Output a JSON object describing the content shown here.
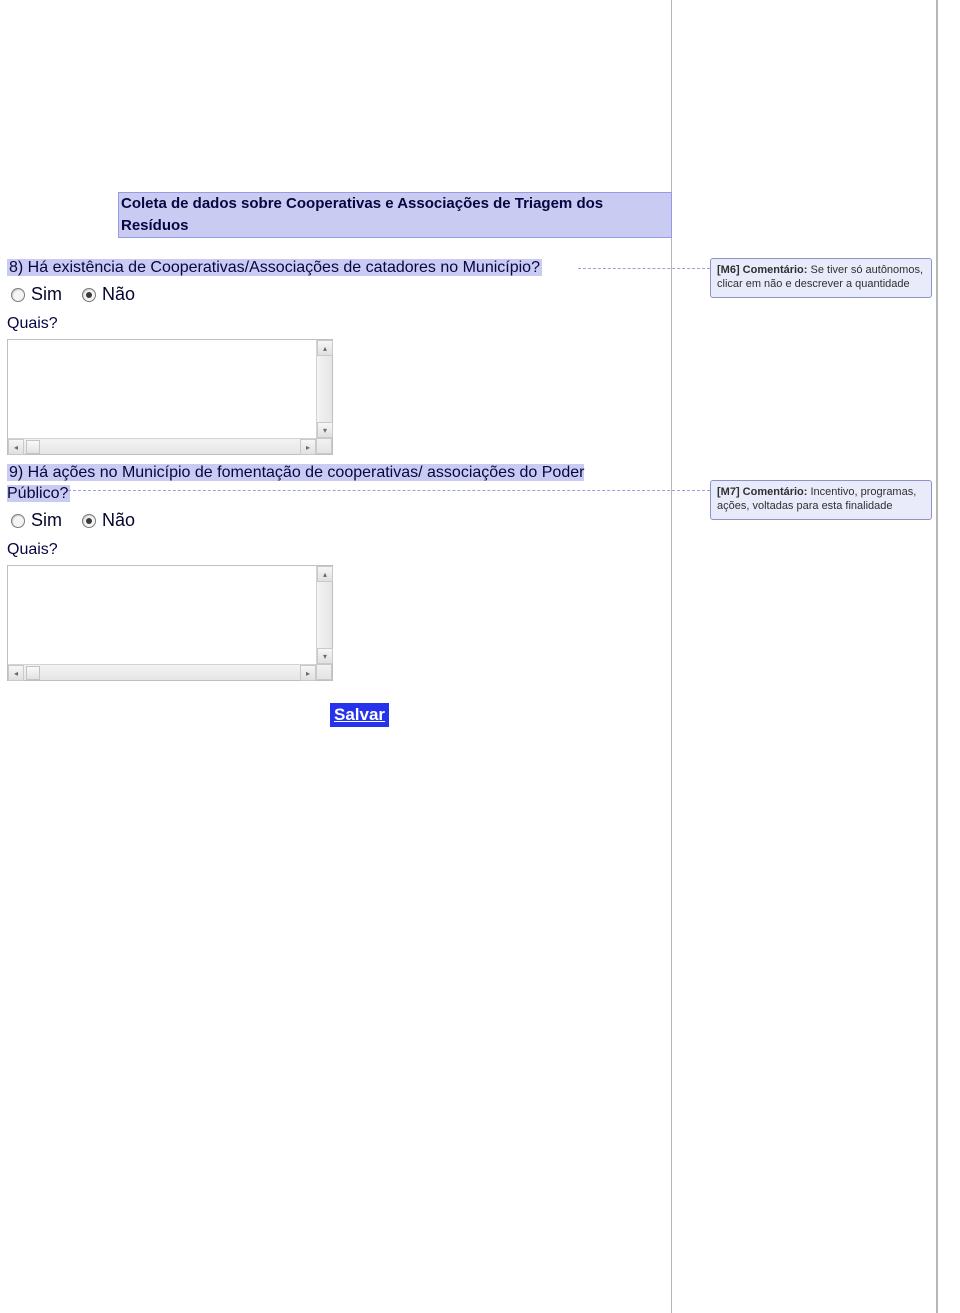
{
  "section": {
    "title": "Coleta de dados sobre Cooperativas e Associações de Triagem dos Resíduos"
  },
  "q8": {
    "text": "8) Há existência de Cooperativas/Associações de catadores no Município?",
    "optionSim": "Sim",
    "optionNao": "Não",
    "quaisLabel": "Quais?"
  },
  "q9": {
    "text": "9) Há ações no Município de fomentação de cooperativas/ associações do Poder Público?",
    "optionSim": "Sim",
    "optionNao": "Não",
    "quaisLabel": "Quais?"
  },
  "saveButton": "Salvar",
  "comments": {
    "m6": {
      "tag": "[M6] Comentário: ",
      "body": "Se tiver só autônomos, clicar em não e  descrever a quantidade"
    },
    "m7": {
      "tag": "[M7] Comentário: ",
      "body": "Incentivo, programas, ações, voltadas para esta finalidade"
    }
  }
}
